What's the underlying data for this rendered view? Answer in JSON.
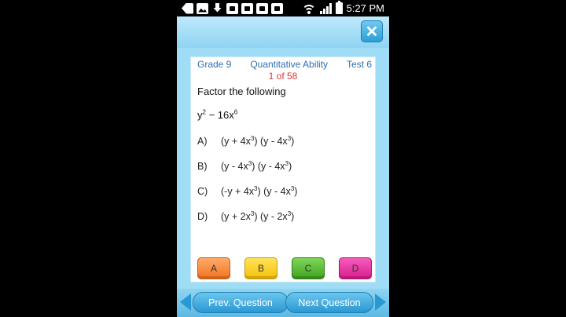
{
  "status_bar": {
    "time": "5:27 PM",
    "icons": [
      "back-icon",
      "image-icon",
      "download-icon",
      "app-icon",
      "app-icon",
      "app-icon",
      "app-icon",
      "wifi-icon",
      "signal-icon",
      "battery-icon"
    ]
  },
  "header": {
    "close_icon": "✕"
  },
  "quiz": {
    "grade": "Grade 9",
    "subject": "Quantitative Ability",
    "test": "Test 6",
    "counter": "1 of 58",
    "prompt": "Factor the following",
    "expression": {
      "base": "y",
      "exp1": "2",
      "mid": " − 16x",
      "exp2": "6"
    },
    "options": [
      {
        "letter": "A)",
        "p1": "(y + 4x",
        "e1": "3",
        "p2": ") (y - 4x",
        "e2": "3",
        "p3": ")"
      },
      {
        "letter": "B)",
        "p1": "(y - 4x",
        "e1": "3",
        "p2": ") (y - 4x",
        "e2": "3",
        "p3": ")"
      },
      {
        "letter": "C)",
        "p1": "(-y + 4x",
        "e1": "3",
        "p2": ") (y - 4x",
        "e2": "3",
        "p3": ")"
      },
      {
        "letter": "D)",
        "p1": "(y + 2x",
        "e1": "3",
        "p2": ") (y - 2x",
        "e2": "3",
        "p3": ")"
      }
    ],
    "answer_buttons": [
      "A",
      "B",
      "C",
      "D"
    ],
    "colors": {
      "meta": "#2f6fb5",
      "counter": "#e0343a"
    }
  },
  "footer": {
    "prev_label": "Prev. Question",
    "next_label": "Next Question"
  }
}
